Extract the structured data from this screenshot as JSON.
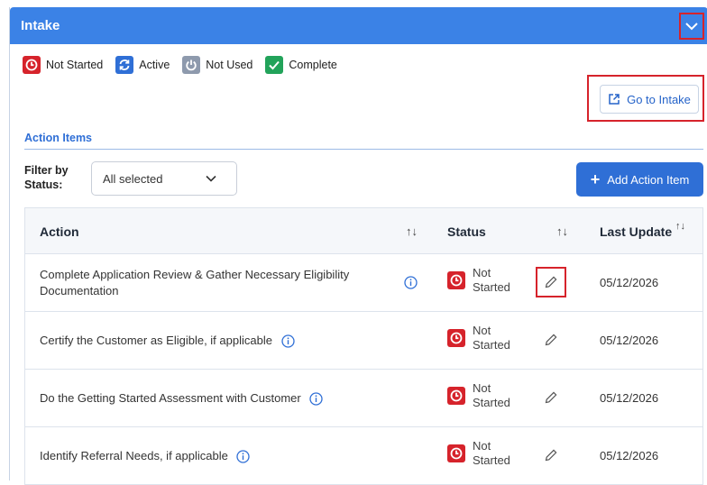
{
  "header": {
    "title": "Intake"
  },
  "legend": [
    {
      "label": "Not Started",
      "color": "#d6232b",
      "icon": "clock-icon"
    },
    {
      "label": "Active",
      "color": "#2f6fd6",
      "icon": "refresh-icon"
    },
    {
      "label": "Not Used",
      "color": "#8e9aad",
      "icon": "power-icon"
    },
    {
      "label": "Complete",
      "color": "#22a35a",
      "icon": "check-icon"
    }
  ],
  "goto": {
    "label": "Go to Intake"
  },
  "section": {
    "title": "Action Items"
  },
  "filter": {
    "label": "Filter by Status:",
    "value": "All selected"
  },
  "add_button": {
    "label": "Add Action Item"
  },
  "table": {
    "headers": {
      "action": "Action",
      "status": "Status",
      "last_update": "Last Update"
    },
    "rows": [
      {
        "action": "Complete Application Review & Gather Necessary Eligibility Documentation",
        "status_line1": "Not",
        "status_line2": "Started",
        "date": "05/12/2026"
      },
      {
        "action": "Certify the Customer as Eligible, if applicable",
        "status_line1": "Not",
        "status_line2": "Started",
        "date": "05/12/2026"
      },
      {
        "action": "Do the Getting Started Assessment with Customer",
        "status_line1": "Not",
        "status_line2": "Started",
        "date": "05/12/2026"
      },
      {
        "action": "Identify Referral Needs, if applicable",
        "status_line1": "Not",
        "status_line2": "Started",
        "date": "05/12/2026"
      }
    ]
  }
}
